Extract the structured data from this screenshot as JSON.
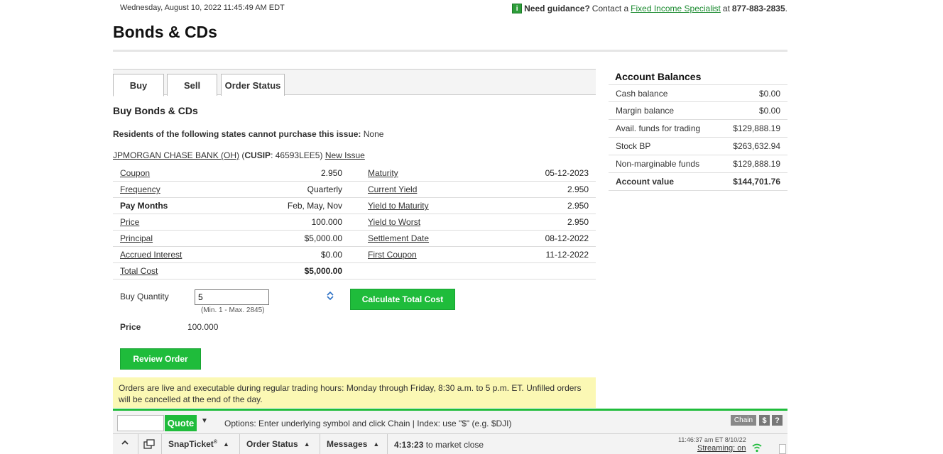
{
  "header": {
    "timestamp": "Wednesday, August 10, 2022 11:45:49 AM EDT",
    "guidance_bold": "Need guidance?",
    "guidance_text": "Contact a",
    "guidance_link": "Fixed Income Specialist",
    "guidance_at": "at",
    "phone": "877-883-2835",
    "period": "."
  },
  "page_title": "Bonds & CDs",
  "tabs": [
    {
      "label": "Buy",
      "active": true
    },
    {
      "label": "Sell",
      "active": false
    },
    {
      "label": "Order Status",
      "active": false
    }
  ],
  "section_title": "Buy Bonds & CDs",
  "residents": {
    "label": "Residents of the following states cannot purchase this issue:",
    "value": "None"
  },
  "issue": {
    "name": "JPMORGAN CHASE BANK (OH)",
    "cusip_label": "CUSIP",
    "cusip": "46593LEE5",
    "new_issue": "New Issue"
  },
  "details": [
    {
      "l_label": "Coupon",
      "l_value": "2.950",
      "r_label": "Maturity",
      "r_value": "05-12-2023"
    },
    {
      "l_label": "Frequency",
      "l_value": "Quarterly",
      "r_label": "Current Yield",
      "r_value": "2.950"
    },
    {
      "l_label": "Pay Months",
      "l_value": "Feb, May, Nov",
      "r_label": "Yield to Maturity",
      "r_value": "2.950"
    },
    {
      "l_label": "Price",
      "l_value": "100.000",
      "r_label": "Yield to Worst",
      "r_value": "2.950"
    },
    {
      "l_label": "Principal",
      "l_value": "$5,000.00",
      "r_label": "Settlement Date",
      "r_value": "08-12-2022"
    },
    {
      "l_label": "Accrued Interest",
      "l_value": "$0.00",
      "r_label": "First Coupon",
      "r_value": "11-12-2022"
    },
    {
      "l_label": "Total Cost",
      "l_value": "$5,000.00",
      "r_label": "",
      "r_value": ""
    }
  ],
  "order": {
    "qty_label": "Buy Quantity",
    "qty_value": "5",
    "qty_hint": "(Min. 1 - Max. 2845)",
    "calc_button": "Calculate Total Cost",
    "price_label": "Price",
    "price_value": "100.000",
    "review_button": "Review Order"
  },
  "notice": "Orders are live and executable during regular trading hours: Monday through Friday, 8:30 a.m. to 5 p.m. ET. Unfilled orders will be cancelled at the end of the day.",
  "account": {
    "title": "Account Balances",
    "rows": [
      {
        "label": "Cash balance",
        "value": "$0.00"
      },
      {
        "label": "Margin balance",
        "value": "$0.00"
      },
      {
        "label": "Avail. funds for trading",
        "value": "$129,888.19"
      },
      {
        "label": "Stock BP",
        "value": "$263,632.94"
      },
      {
        "label": "Non-marginable funds",
        "value": "$129,888.19"
      },
      {
        "label": "Account value",
        "value": "$144,701.76"
      }
    ]
  },
  "quote_bar": {
    "quote_button": "Quote",
    "hint": "Options: Enter underlying symbol and click Chain | Index: use \"$\" (e.g. $DJI)",
    "chain": "Chain",
    "dollar": "$",
    "help": "?",
    "snapticket": "SnapTicket",
    "reg": "®",
    "order_status": "Order Status",
    "messages": "Messages",
    "countdown": "4:13:23",
    "countdown_suffix": "to market close",
    "stream_time": "11:46:37 am ET 8/10/22",
    "streaming": "Streaming: on"
  },
  "colors": {
    "accent_green": "#1fbc3b",
    "notice_bg": "#fbf8b4"
  }
}
